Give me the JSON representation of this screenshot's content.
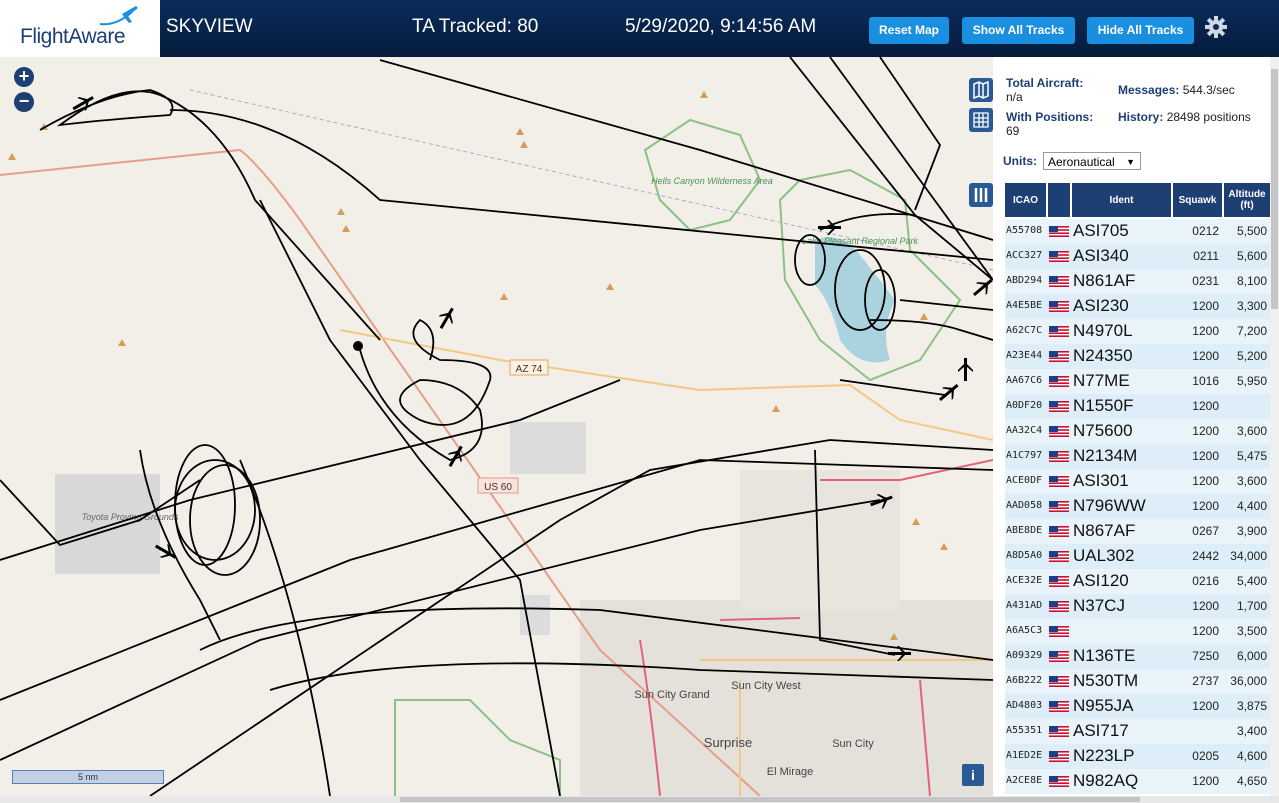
{
  "header": {
    "logo_text": "FlightAware",
    "site_name": "SKYVIEW",
    "tracked": "TA Tracked: 80",
    "datetime": "5/29/2020, 9:14:56 AM",
    "buttons": {
      "reset": "Reset Map",
      "show_all": "Show All Tracks",
      "hide_all": "Hide All Tracks"
    }
  },
  "map": {
    "zoom_in": "+",
    "zoom_out": "−",
    "scale_label": "5 nm",
    "info_label": "i",
    "labels": {
      "az74": "AZ 74",
      "us60": "US 60",
      "hells_canyon": "Hells Canyon Wilderness Area",
      "lake_pleasant": "Lake Pleasant Regional Park",
      "toyota": "Toyota Proving Grounds",
      "sun_city_grand": "Sun City Grand",
      "sun_city_west": "Sun City West",
      "surprise": "Surprise",
      "sun_city": "Sun City",
      "el_mirage": "El Mirage"
    }
  },
  "stats": {
    "total_aircraft_label": "Total Aircraft:",
    "total_aircraft_value": "n/a",
    "with_positions_label": "With Positions:",
    "with_positions_value": "69",
    "messages_label": "Messages:",
    "messages_value": "544.3/sec",
    "history_label": "History:",
    "history_value": "28498 positions",
    "units_label": "Units:",
    "units_value": "Aeronautical"
  },
  "table": {
    "columns": [
      "ICAO",
      "",
      "Ident",
      "Squawk",
      "Altitude (ft)"
    ],
    "rows": [
      {
        "icao": "A55708",
        "ident": "ASI705",
        "squawk": "0212",
        "alt": "5,500"
      },
      {
        "icao": "ACC327",
        "ident": "ASI340",
        "squawk": "0211",
        "alt": "5,600"
      },
      {
        "icao": "ABD294",
        "ident": "N861AF",
        "squawk": "0231",
        "alt": "8,100"
      },
      {
        "icao": "A4E5BE",
        "ident": "ASI230",
        "squawk": "1200",
        "alt": "3,300"
      },
      {
        "icao": "A62C7C",
        "ident": "N4970L",
        "squawk": "1200",
        "alt": "7,200"
      },
      {
        "icao": "A23E44",
        "ident": "N24350",
        "squawk": "1200",
        "alt": "5,200"
      },
      {
        "icao": "AA67C6",
        "ident": "N77ME",
        "squawk": "1016",
        "alt": "5,950"
      },
      {
        "icao": "A0DF20",
        "ident": "N1550F",
        "squawk": "1200",
        "alt": ""
      },
      {
        "icao": "AA32C4",
        "ident": "N75600",
        "squawk": "1200",
        "alt": "3,600"
      },
      {
        "icao": "A1C797",
        "ident": "N2134M",
        "squawk": "1200",
        "alt": "5,475"
      },
      {
        "icao": "ACE0DF",
        "ident": "ASI301",
        "squawk": "1200",
        "alt": "3,600"
      },
      {
        "icao": "AAD058",
        "ident": "N796WW",
        "squawk": "1200",
        "alt": "4,400"
      },
      {
        "icao": "ABE8DE",
        "ident": "N867AF",
        "squawk": "0267",
        "alt": "3,900"
      },
      {
        "icao": "A8D5A0",
        "ident": "UAL302",
        "squawk": "2442",
        "alt": "34,000"
      },
      {
        "icao": "ACE32E",
        "ident": "ASI120",
        "squawk": "0216",
        "alt": "5,400"
      },
      {
        "icao": "A431AD",
        "ident": "N37CJ",
        "squawk": "1200",
        "alt": "1,700"
      },
      {
        "icao": "A6A5C3",
        "ident": "",
        "squawk": "1200",
        "alt": "3,500"
      },
      {
        "icao": "A09329",
        "ident": "N136TE",
        "squawk": "7250",
        "alt": "6,000"
      },
      {
        "icao": "A6B222",
        "ident": "N530TM",
        "squawk": "2737",
        "alt": "36,000"
      },
      {
        "icao": "AD4803",
        "ident": "N955JA",
        "squawk": "1200",
        "alt": "3,875"
      },
      {
        "icao": "A55351",
        "ident": "ASI717",
        "squawk": "",
        "alt": "3,400"
      },
      {
        "icao": "A1ED2E",
        "ident": "N223LP",
        "squawk": "0205",
        "alt": "4,600"
      },
      {
        "icao": "A2CE8E",
        "ident": "N982AQ",
        "squawk": "1200",
        "alt": "4,650"
      }
    ]
  },
  "colors": {
    "header_bg": "#0a2d5c",
    "button": "#1a8fe0",
    "table_head": "#1d3f73",
    "row": "#ddeef8",
    "track": "#000000",
    "water": "#aad3df"
  }
}
